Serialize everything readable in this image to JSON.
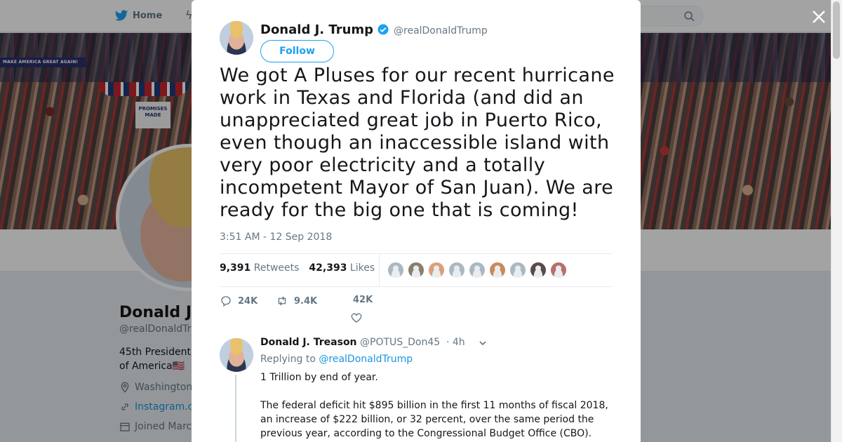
{
  "nav": {
    "home_label": "Home"
  },
  "profile": {
    "name": "Donald J.",
    "handle": "@realDonaldTr",
    "bio": "45th President of America🇺🇸",
    "location": "Washington",
    "link": "Instagram.c",
    "joined": "Joined Marc"
  },
  "banner": {
    "sign_text": "MAKE AMERICA GREAT AGAIN!",
    "sign2_text": "PROMISES MADE"
  },
  "tweet": {
    "author_name": "Donald J. Trump",
    "author_handle": "@realDonaldTrump",
    "follow_label": "Follow",
    "text": "We got A Pluses for our recent hurricane work in Texas and Florida (and did an unappreciated great job in Puerto Rico, even though an inaccessible island with very poor electricity and a totally incompetent Mayor of San Juan). We are ready for the big one that is coming!",
    "timestamp": "3:51 AM - 12 Sep 2018",
    "retweets_count": "9,391",
    "retweets_label": "Retweets",
    "likes_count": "42,393",
    "likes_label": "Likes",
    "reply_count": "24K",
    "retweet_action_count": "9.4K",
    "like_action_count": "42K"
  },
  "likers": [
    "#aab8c2",
    "#8a7f6a",
    "#d9a07a",
    "#aab8c2",
    "#aab8c2",
    "#c98a5a",
    "#aab8c2",
    "#5a4a48",
    "#b7706a"
  ],
  "reply": {
    "author_name": "Donald J. Treason",
    "author_handle": "@POTUS_Don45",
    "time": "· 4h",
    "replying_prefix": "Replying to",
    "replying_to": "@realDonaldTrump",
    "line1": "1 Trillion by end of year.",
    "line2": "The federal deficit hit $895 billion in the first 11 months of fiscal 2018, an increase of $222 billion, or 32 percent, over the same period the previous year, according to the Congressional Budget Office (CBO)."
  },
  "colors": {
    "accent": "#1da1f2",
    "link": "#1b95e0",
    "muted": "#657786"
  }
}
